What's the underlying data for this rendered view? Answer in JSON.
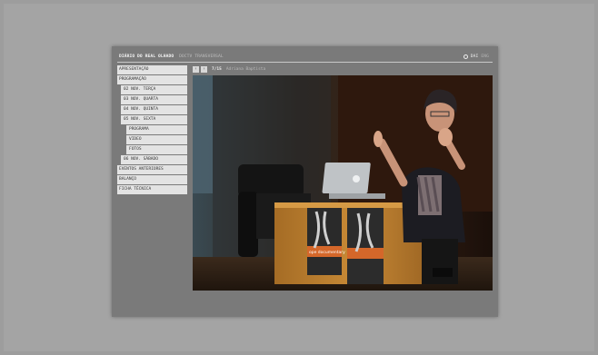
{
  "header": {
    "title": "DIÁRIO DO REAL OLHADO",
    "subtitle": "DOCTV TRANSVERSAL",
    "lang_active": "DAI",
    "lang_other": "ENG"
  },
  "menu": {
    "items": [
      {
        "label": "APRESENTAÇÃO",
        "level": 0
      },
      {
        "label": "PROGRAMAÇÃO",
        "level": 0
      },
      {
        "label": "02 NOV. TERÇA",
        "level": 1
      },
      {
        "label": "03 NOV. QUARTA",
        "level": 1
      },
      {
        "label": "04 NOV. QUINTA",
        "level": 1
      },
      {
        "label": "05 NOV. SEXTA",
        "level": 1
      },
      {
        "label": "PROGRAMA",
        "level": 2
      },
      {
        "label": "VIDEO",
        "level": 2
      },
      {
        "label": "FOTOS",
        "level": 2
      },
      {
        "label": "06 NOV. SÁBADO",
        "level": 1
      },
      {
        "label": "EVENTOS ANTERIORES",
        "level": 0
      },
      {
        "label": "BALANÇO",
        "level": 0
      },
      {
        "label": "FICHA TÉCNICA",
        "level": 0
      }
    ]
  },
  "gallery": {
    "prev": "‹",
    "next": "›",
    "counter": "7/15",
    "caption": "Adriana Baptista",
    "book_text": "ope documentary"
  },
  "colors": {
    "menu_bg": "#e3e3e3",
    "window_bg": "#7a7a7a",
    "page_bg": "#9d9d9d"
  }
}
